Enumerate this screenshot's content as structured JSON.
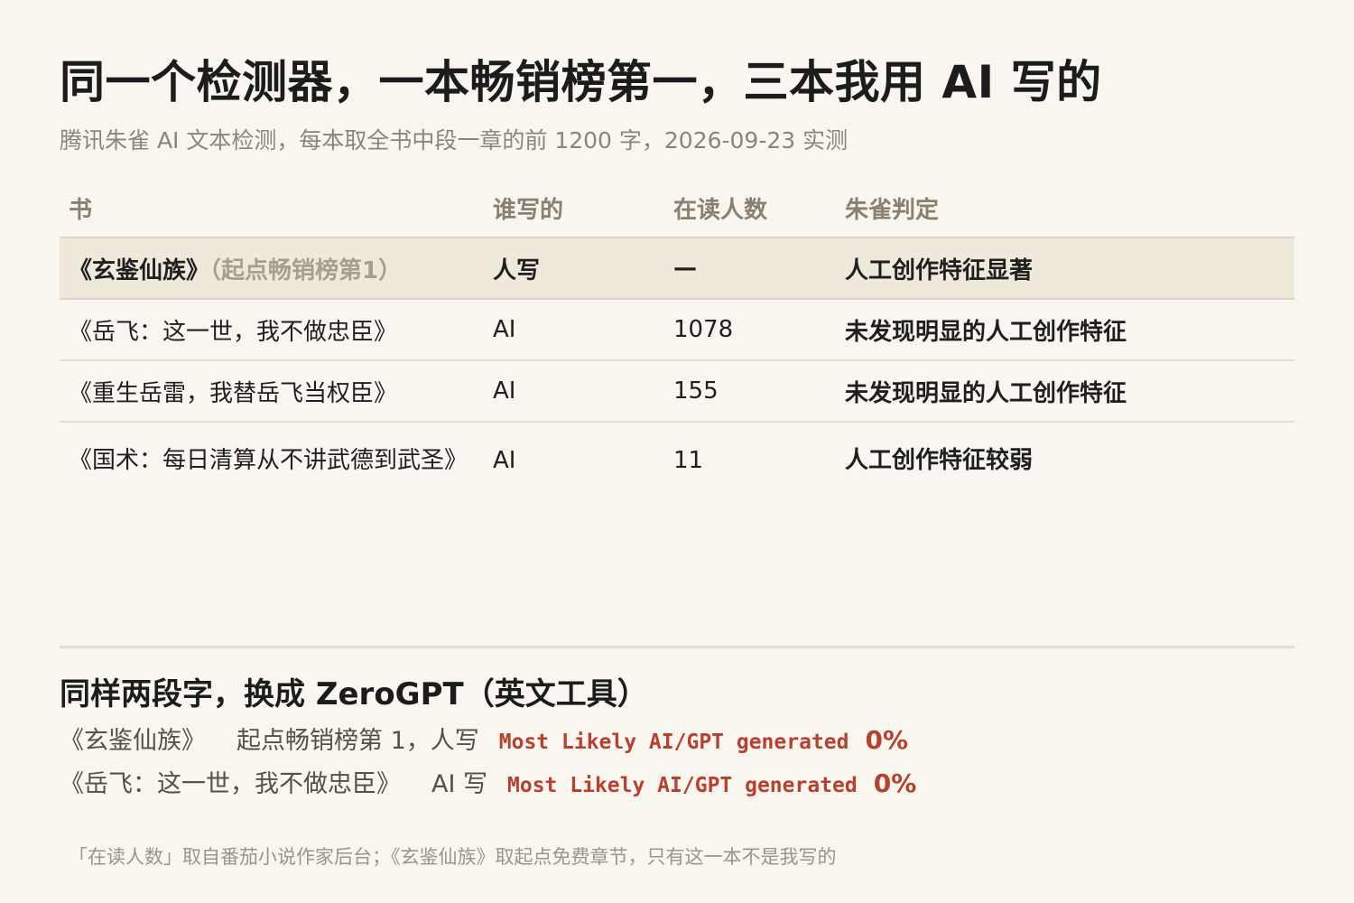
{
  "title": "同一个检测器，一本畅销榜第一，三本我用 AI 写的",
  "subtitle": "腾讯朱雀 AI 文本检测，每本取全书中段一章的前 1200 字，2026-09-23 实测",
  "table": {
    "headers": [
      "书",
      "谁写的",
      "在读人数",
      "朱雀判定"
    ],
    "rows": [
      {
        "book": "《玄鉴仙族》",
        "note": "（起点畅销榜第1）",
        "author": "人写",
        "readers": "—",
        "verdict": "人工创作特征显著",
        "verdict_color": "#2e7d4a"
      },
      {
        "book": "《岳飞：这一世，我不做忠臣》",
        "note": "",
        "author": "AI",
        "readers": "1078",
        "verdict": "未发现明显的人工创作特征",
        "verdict_color": "#b8402f"
      },
      {
        "book": "《重生岳雷，我替岳飞当权臣》",
        "note": "",
        "author": "AI",
        "readers": "155",
        "verdict": "未发现明显的人工创作特征",
        "verdict_color": "#b8402f"
      },
      {
        "book": "《国术：每日清算从不讲武德到武圣》",
        "note": "",
        "author": "AI",
        "readers": "11",
        "verdict": "人工创作特征较弱",
        "verdict_color": "#b8402f"
      }
    ]
  },
  "section2": {
    "title": "同样两段字，换成 ZeroGPT（英文工具）",
    "rows": [
      {
        "book": "《玄鉴仙族》",
        "info": "起点畅销榜第 1，人写",
        "result": "Most Likely AI/GPT generated",
        "percent": "0%"
      },
      {
        "book": "《岳飞：这一世，我不做忠臣》",
        "info": "AI 写",
        "result": "Most Likely AI/GPT generated",
        "percent": "0%"
      }
    ]
  },
  "footnote": "「在读人数」取自番茄小说作家后台；《玄鉴仙族》取起点免费章节，只有这一本不是我写的",
  "colors": {
    "background": "#f9f6f0",
    "highlight_row": "#efe9dc",
    "green": "#2e7d4a",
    "red": "#b8402f",
    "header_text": "#8b7f70",
    "muted": "#8a857c"
  }
}
